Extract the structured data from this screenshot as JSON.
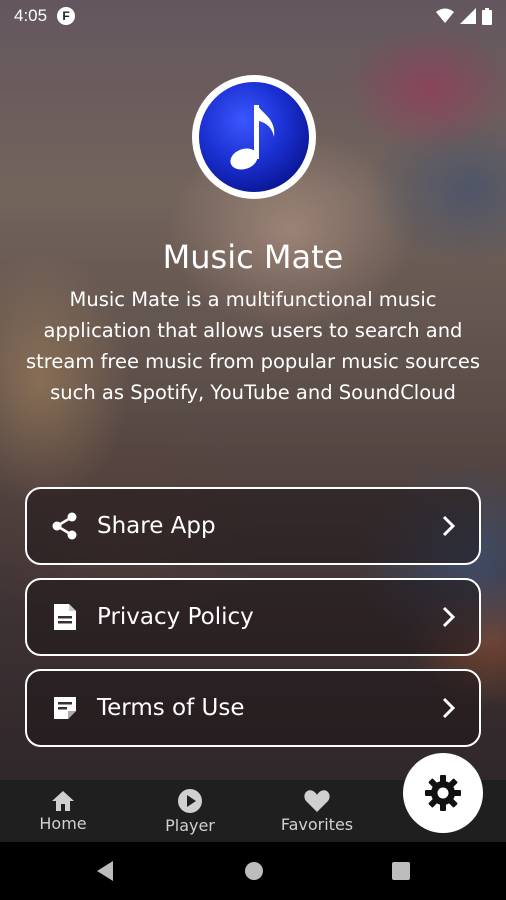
{
  "status": {
    "time": "4:05",
    "app_badge": "F"
  },
  "app": {
    "title": "Music Mate",
    "description": "Music Mate is a multifunctional music application that allows users to search and stream free music from popular music sources such as Spotify, YouTube and SoundCloud",
    "logo_icon": "music-note-icon"
  },
  "menu": [
    {
      "label": "Share App",
      "icon": "share-icon"
    },
    {
      "label": "Privacy Policy",
      "icon": "document-icon"
    },
    {
      "label": "Terms of Use",
      "icon": "note-icon"
    }
  ],
  "bottom_nav": [
    {
      "label": "Home",
      "icon": "home-icon"
    },
    {
      "label": "Player",
      "icon": "play-circle-icon"
    },
    {
      "label": "Favorites",
      "icon": "heart-icon"
    }
  ],
  "fab": {
    "icon": "gear-icon"
  },
  "colors": {
    "nav_bg": "#1f1f1f",
    "logo_blue": "#1a2fd0",
    "nav_label": "#d0d0d0"
  }
}
